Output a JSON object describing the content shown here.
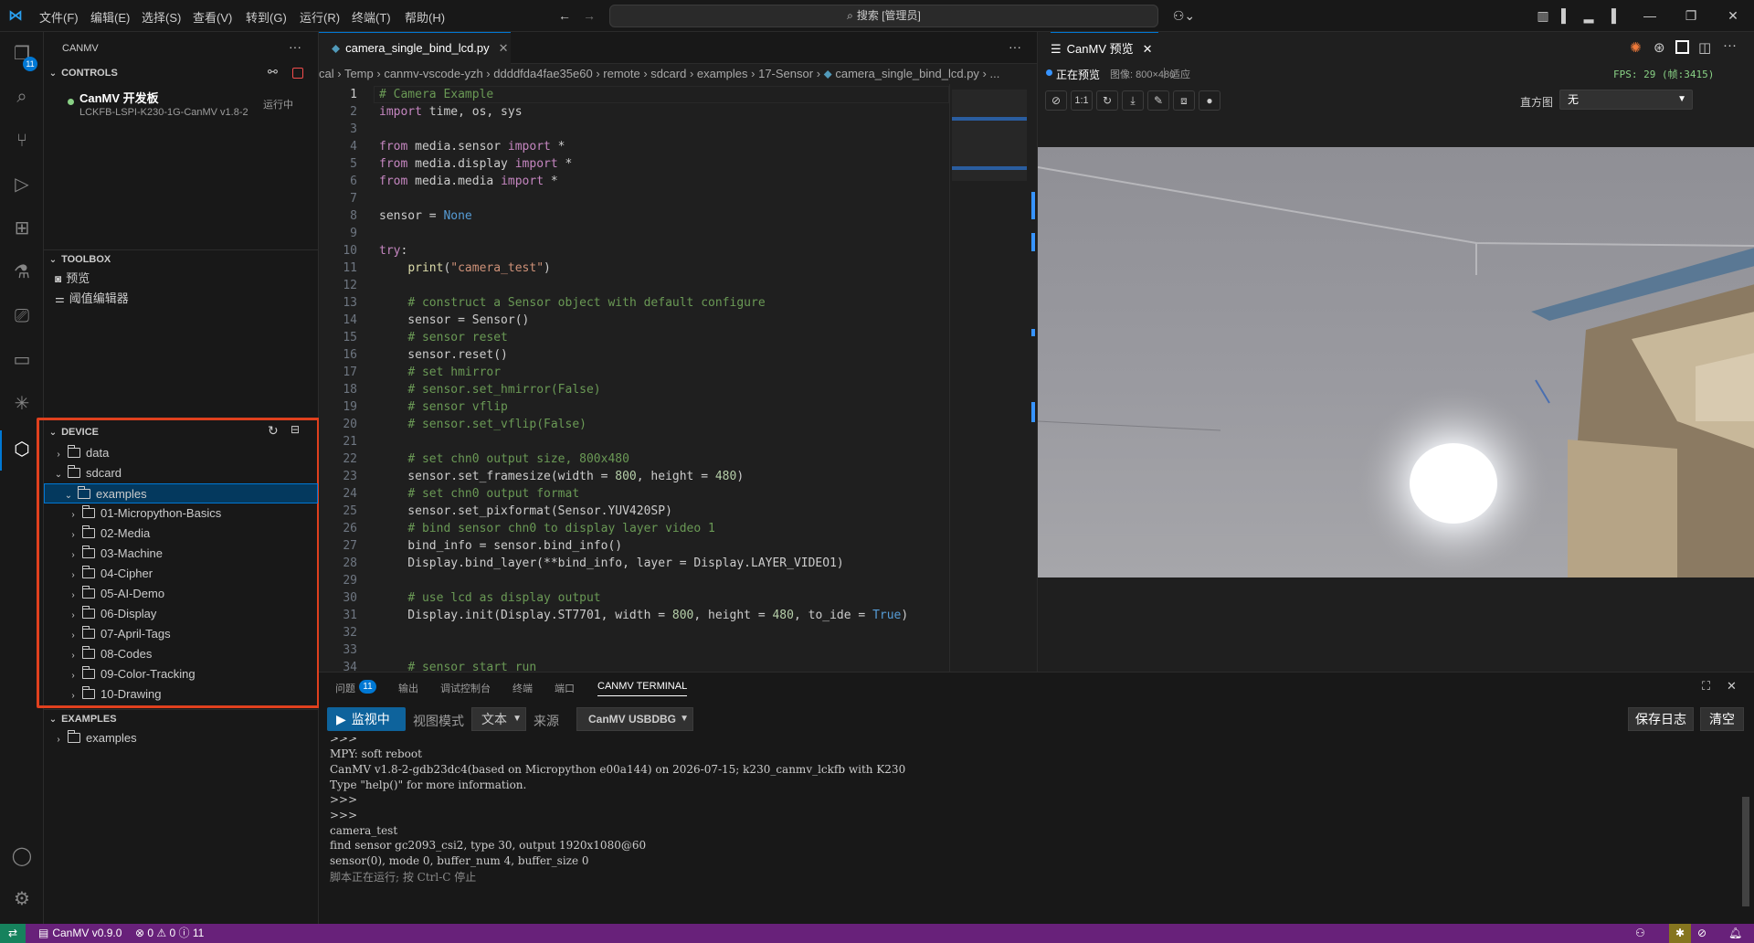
{
  "titlebar": {
    "menu": [
      "文件(F)",
      "编辑(E)",
      "选择(S)",
      "查看(V)",
      "转到(G)",
      "运行(R)",
      "终端(T)",
      "帮助(H)"
    ],
    "search_placeholder": "搜索 [管理员]"
  },
  "activity_badge": "11",
  "sidebar": {
    "title": "CANMV",
    "controls_title": "CONTROLS",
    "device_name": "CanMV 开发板",
    "device_id": "LCKFB-LSPI-K230-1G-CanMV v1.8-2",
    "device_status": "运行中",
    "toolbox_title": "TOOLBOX",
    "toolbox_items": [
      "预览",
      "阈值编辑器"
    ],
    "device_title": "DEVICE",
    "device_tree": [
      "data",
      "sdcard",
      "examples",
      "01-Micropython-Basics",
      "02-Media",
      "03-Machine",
      "04-Cipher",
      "05-AI-Demo",
      "06-Display",
      "07-April-Tags",
      "08-Codes",
      "09-Color-Tracking",
      "10-Drawing"
    ],
    "examples_title": "EXAMPLES",
    "examples_item": "examples"
  },
  "editor": {
    "tab_label": "camera_single_bind_lcd.py",
    "breadcrumb": [
      "cal",
      "Temp",
      "canmv-vscode-yzh",
      "ddddfda4fae35e60",
      "remote",
      "sdcard",
      "examples",
      "17-Sensor",
      "camera_single_bind_lcd.py",
      "..."
    ],
    "line_numbers": [
      "1",
      "2",
      "3",
      "4",
      "5",
      "6",
      "7",
      "8",
      "9",
      "10",
      "11",
      "12",
      "13",
      "14",
      "15",
      "16",
      "17",
      "18",
      "19",
      "20",
      "21",
      "22",
      "23",
      "24",
      "25",
      "26",
      "27",
      "28",
      "29",
      "30",
      "31",
      "32",
      "33",
      "34"
    ]
  },
  "preview": {
    "tab_label": "CanMV 预览",
    "status": "正在预览",
    "image_label": "图像: 800×480",
    "fit_label": "适应",
    "fps": "FPS: 29 (帧:3415)",
    "zoom_label": "1:1",
    "histogram_label": "直方图",
    "histogram_value": "无"
  },
  "panel": {
    "tabs": [
      "问题",
      "输出",
      "调试控制台",
      "终端",
      "端口",
      "CANMV TERMINAL"
    ],
    "problems_count": "11",
    "monitor_button": "监视中",
    "view_mode": "视图模式",
    "text_select": "文本",
    "source_label": "来源",
    "source_select": "CanMV USBDBG",
    "save_log": "保存日志",
    "clear": "清空",
    "terminal_lines": [
      ">>>",
      "MPY: soft reboot",
      "CanMV v1.8-2-gdb23dc4(based on Micropython e00a144) on 2026-07-15; k230_canmv_lckfb with K230",
      "Type \"help()\" for more information.",
      ">>>",
      ">>>",
      "camera_test",
      "find sensor gc2093_csi2, type 30, output 1920x1080@60",
      "sensor(0), mode 0, buffer_num 4, buffer_size 0",
      "脚本正在运行; 按 Ctrl-C 停止"
    ]
  },
  "statusbar": {
    "extension": "CanMV v0.9.0",
    "problems": "⊗ 0 ⚠ 0 ⓘ 11"
  },
  "colors": {
    "accent": "#0078d4",
    "statusbar": "#68217a",
    "highlight_box": "#e0401e",
    "run_button": "#0e639c"
  }
}
